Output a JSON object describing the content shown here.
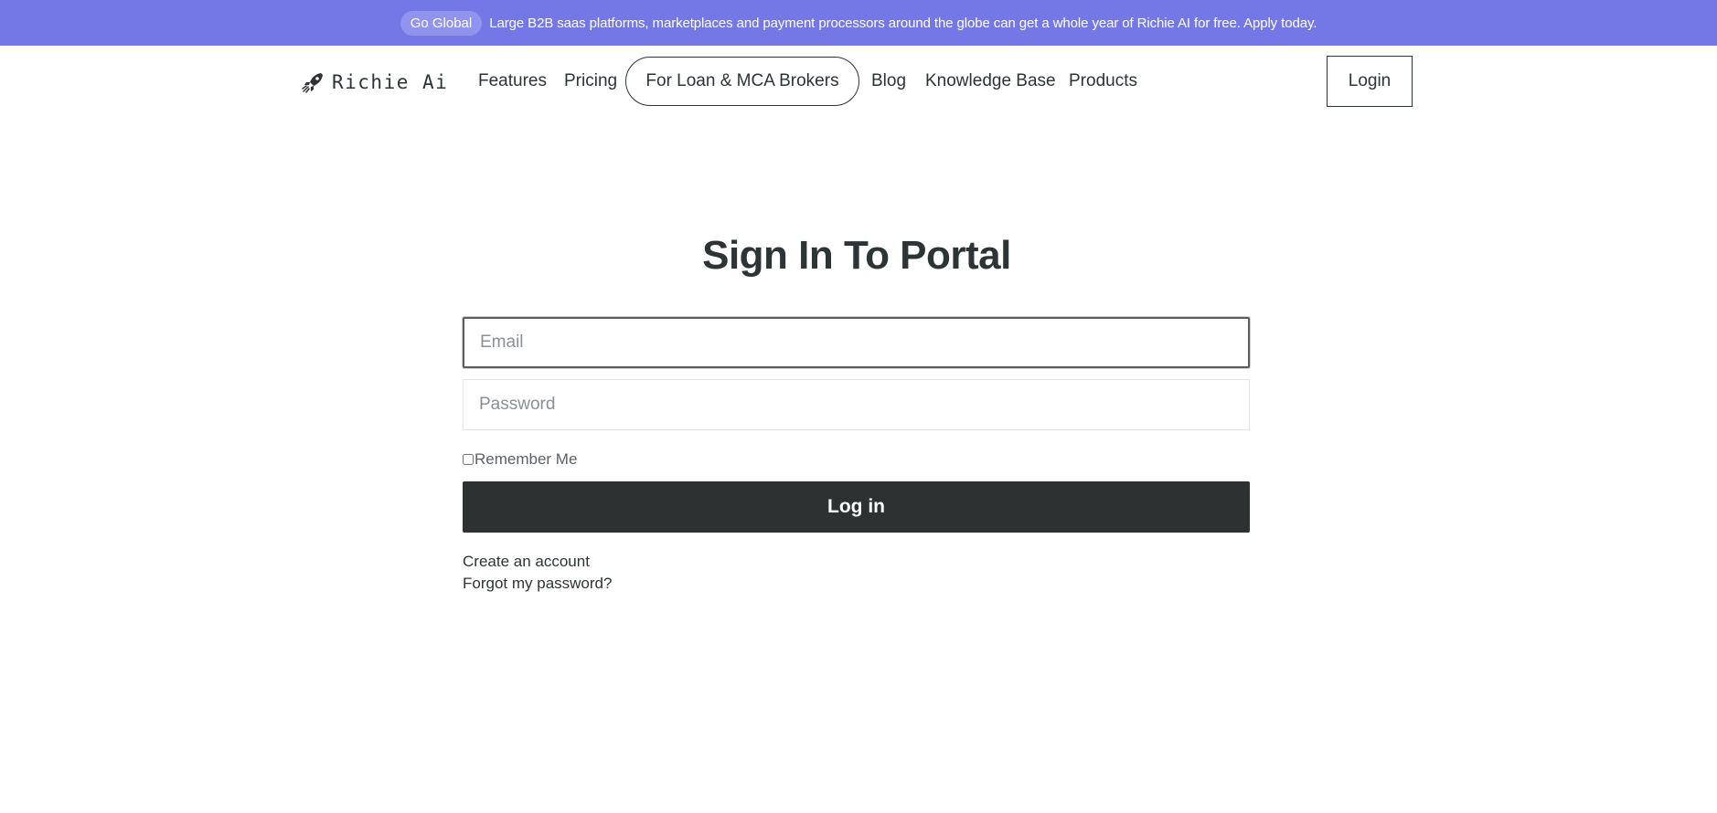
{
  "banner": {
    "badge": "Go Global",
    "message": "Large B2B saas platforms, marketplaces and payment processors around the globe can get a whole year of Richie AI for free. Apply today.",
    "background_color": "#7478e6"
  },
  "header": {
    "logo_icon": "rocket-icon",
    "logo_text": "Richie Ai",
    "nav": {
      "features": "Features",
      "pricing": "Pricing",
      "brokers": "For Loan & MCA Brokers",
      "blog": "Blog",
      "knowledge_base": "Knowledge Base",
      "products": "Products"
    },
    "login": "Login"
  },
  "form": {
    "title": "Sign In To Portal",
    "email_placeholder": "Email",
    "password_placeholder": "Password",
    "remember_label": "Remember Me",
    "submit_label": "Log in",
    "create_account": "Create an account",
    "forgot_password": "Forgot my password?",
    "button_color": "#2d3132"
  }
}
